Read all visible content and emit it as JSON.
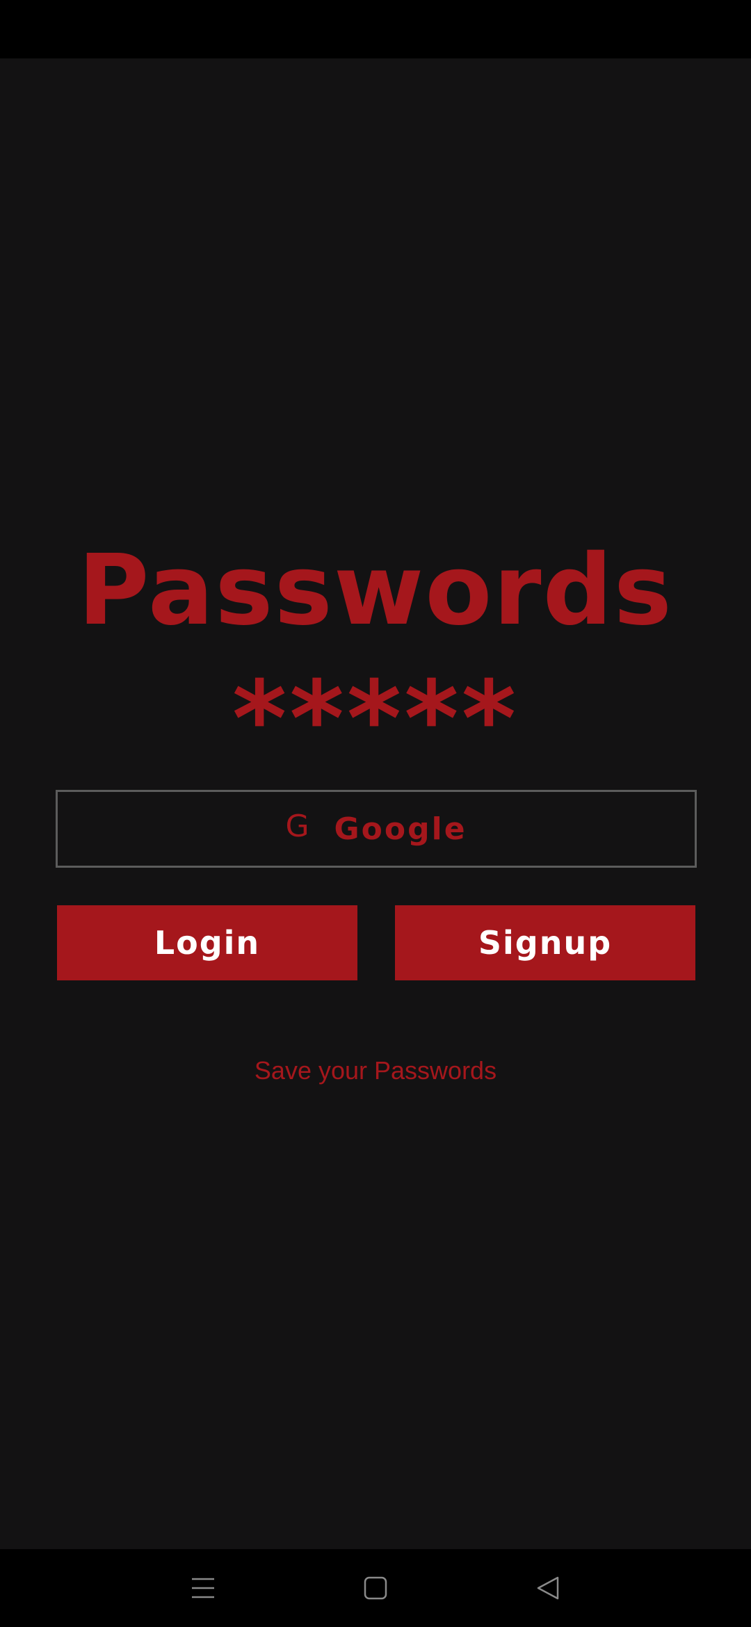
{
  "app": {
    "title": "Passwords",
    "stars": "*****",
    "tagline": "Save your Passwords"
  },
  "buttons": {
    "google_icon": "G",
    "google_label": "Google",
    "login_label": "Login",
    "signup_label": "Signup"
  },
  "icons": {
    "google": "google-icon",
    "menu": "menu-icon",
    "home": "home-icon",
    "back": "back-icon"
  },
  "colors": {
    "accent": "#a5171c",
    "background": "#131213",
    "bars": "#000000",
    "border": "#5c5c5c",
    "button_text": "#ffffff",
    "nav_icons": "#8a8a8a"
  }
}
